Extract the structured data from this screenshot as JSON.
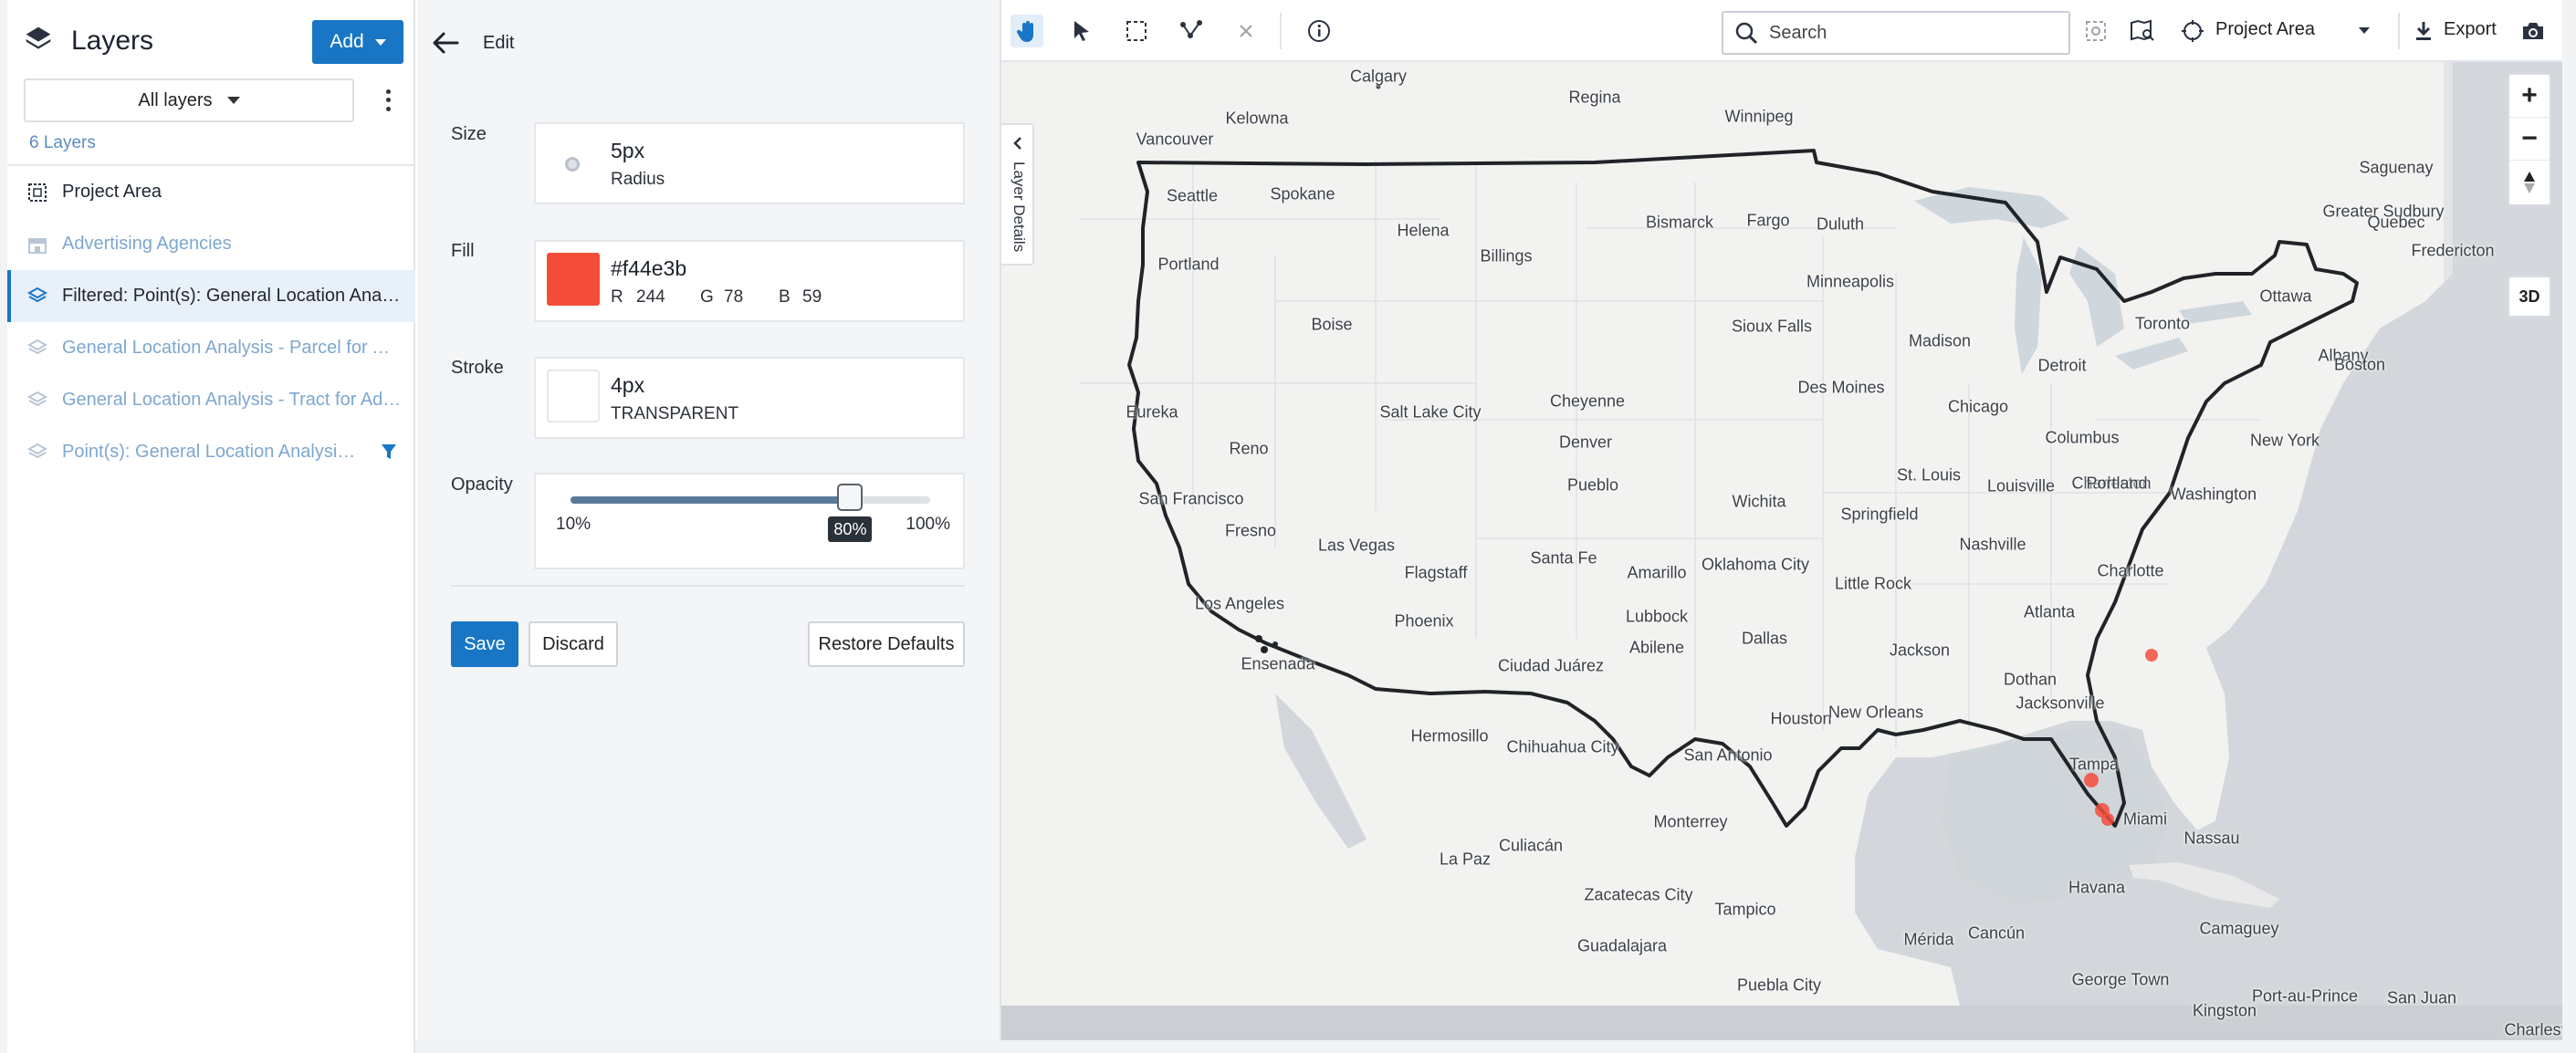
{
  "left_panel": {
    "title": "Layers",
    "add_label": "Add",
    "filter_value": "All layers",
    "layer_count": "6 Layers",
    "layers": [
      {
        "label": "Project Area",
        "icon": "grid-outline-icon",
        "state": "dark"
      },
      {
        "label": "Advertising Agencies",
        "icon": "building-icon",
        "state": "faded"
      },
      {
        "label": "Filtered: Point(s): General Location Analysis - Parcel for Advertising Agencies",
        "icon": "stack-icon",
        "state": "active"
      },
      {
        "label": "General Location Analysis - Parcel for Advertising Agencies",
        "icon": "stack-icon",
        "state": "faded"
      },
      {
        "label": "General Location Analysis - Tract for Advertising Agencies",
        "icon": "stack-icon",
        "state": "faded"
      },
      {
        "label": "Point(s): General Location Analysis - Parcel",
        "icon": "stack-icon",
        "state": "faded",
        "filtered": true
      }
    ]
  },
  "edit_panel": {
    "title": "Edit",
    "size": {
      "label": "Size",
      "value": "5px",
      "sub": "Radius"
    },
    "fill": {
      "label": "Fill",
      "hex": "#f44e3b",
      "r_label": "R",
      "r": "244",
      "g_label": "G",
      "g": "78",
      "b_label": "B",
      "b": "59"
    },
    "stroke": {
      "label": "Stroke",
      "value": "4px",
      "sub": "TRANSPARENT"
    },
    "opacity": {
      "label": "Opacity",
      "min": "10%",
      "max": "100%",
      "value_label": "80%",
      "value": 0.8
    },
    "save_label": "Save",
    "discard_label": "Discard",
    "restore_label": "Restore Defaults"
  },
  "map": {
    "search_placeholder": "Search",
    "project_area_label": "Project Area",
    "export_label": "Export",
    "layer_details_label": "Layer Details",
    "zoom_in": "+",
    "zoom_out": "−",
    "three_d": "3D",
    "cities": [
      "Calgary",
      "Regina",
      "Winnipeg",
      "Kelowna",
      "Vancouver",
      "Saguenay",
      "Greater Sudbury",
      "Quebec",
      "Seattle",
      "Spokane",
      "Helena",
      "Bismarck",
      "Fargo",
      "Duluth",
      "Fredericton",
      "Portland",
      "Billings",
      "Minneapolis",
      "Ottawa",
      "Boise",
      "Sioux Falls",
      "Madison",
      "Toronto",
      "Albany",
      "Boston",
      "Eureka",
      "Salt Lake City",
      "Cheyenne",
      "Des Moines",
      "Detroit",
      "Chicago",
      "Reno",
      "Denver",
      "Columbus",
      "New York",
      "San Francisco",
      "Pueblo",
      "St. Louis",
      "Louisville",
      "Charleston",
      "Washington",
      "Fresno",
      "Wichita",
      "Springfield",
      "Nashville",
      "Las Vegas",
      "Flagstaff",
      "Santa Fe",
      "Amarillo",
      "Oklahoma City",
      "Little Rock",
      "Charlotte",
      "Los Angeles",
      "Phoenix",
      "Lubbock",
      "Atlanta",
      "Ensenada",
      "Ciudad Juárez",
      "Abilene",
      "Dallas",
      "Jackson",
      "Dothan",
      "Jacksonville",
      "Houston",
      "New Orleans",
      "Hermosillo",
      "Chihuahua City",
      "San Antonio",
      "Tampa",
      "Miami",
      "Nassau",
      "Monterrey",
      "La Paz",
      "Culiacán",
      "Havana",
      "Zacatecas City",
      "Tampico",
      "Camaguey",
      "Mérida",
      "Cancún",
      "Guadalajara",
      "Puebla City",
      "George Town",
      "Port-au-Prince",
      "Kingston",
      "San Juan",
      "Charlest",
      "Portland"
    ],
    "icons": [
      "hand-pan-icon",
      "pointer-icon",
      "rectangle-select-icon",
      "polyline-icon",
      "close-icon",
      "info-icon",
      "search-icon",
      "map-search-icon",
      "map-layers-icon",
      "target-icon",
      "chevron-down-icon",
      "download-icon",
      "camera-icon",
      "compass-icon"
    ]
  }
}
